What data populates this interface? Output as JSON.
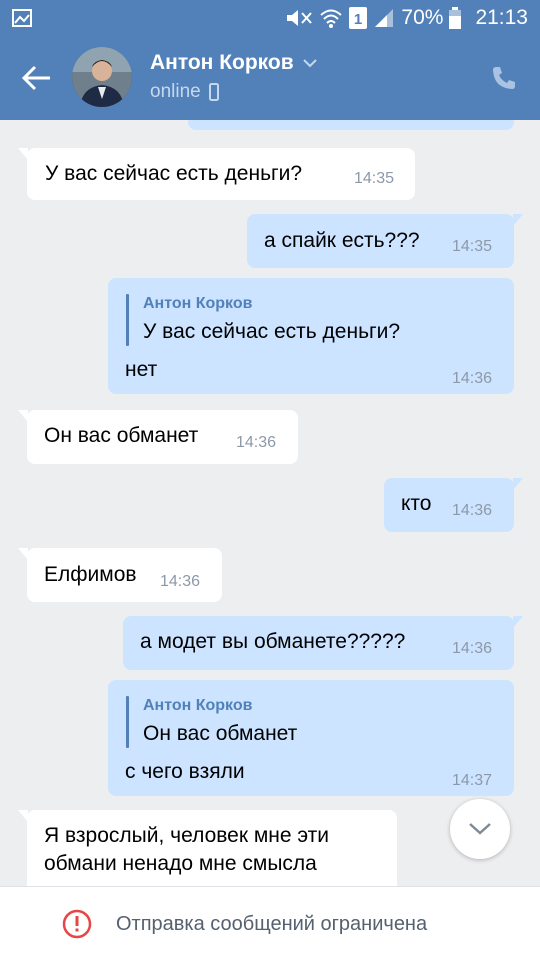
{
  "status_bar": {
    "battery": "70%",
    "time": "21:13",
    "sim": "1"
  },
  "header": {
    "name": "Антон Корков",
    "status": "online"
  },
  "messages": [
    {
      "dir": "in",
      "text": "У вас сейчас есть деньги?",
      "time": "14:35"
    },
    {
      "dir": "out",
      "text": "а спайк есть???",
      "time": "14:35"
    },
    {
      "dir": "out",
      "quote_author": "Антон Корков",
      "quote_text": "У вас сейчас есть деньги?",
      "text": "нет",
      "time": "14:36"
    },
    {
      "dir": "in",
      "text": "Он вас обманет",
      "time": "14:36"
    },
    {
      "dir": "out",
      "text": "кто",
      "time": "14:36"
    },
    {
      "dir": "in",
      "text": "Елфимов",
      "time": "14:36"
    },
    {
      "dir": "out",
      "text": "а модет вы обманете?????",
      "time": "14:36"
    },
    {
      "dir": "out",
      "quote_author": "Антон Корков",
      "quote_text": "Он вас обманет",
      "text": "с чего взяли",
      "time": "14:37"
    },
    {
      "dir": "in",
      "line1": "Я взрослый, человек мне эти",
      "line2": "обмани ненадо мне смысла"
    }
  ],
  "bottom_bar": {
    "text": "Отправка сообщений ограничена"
  },
  "colors": {
    "header": "#5181b8",
    "outgoing_bubble": "#cce4ff",
    "incoming_bubble": "#ffffff",
    "background": "#edeef0"
  }
}
